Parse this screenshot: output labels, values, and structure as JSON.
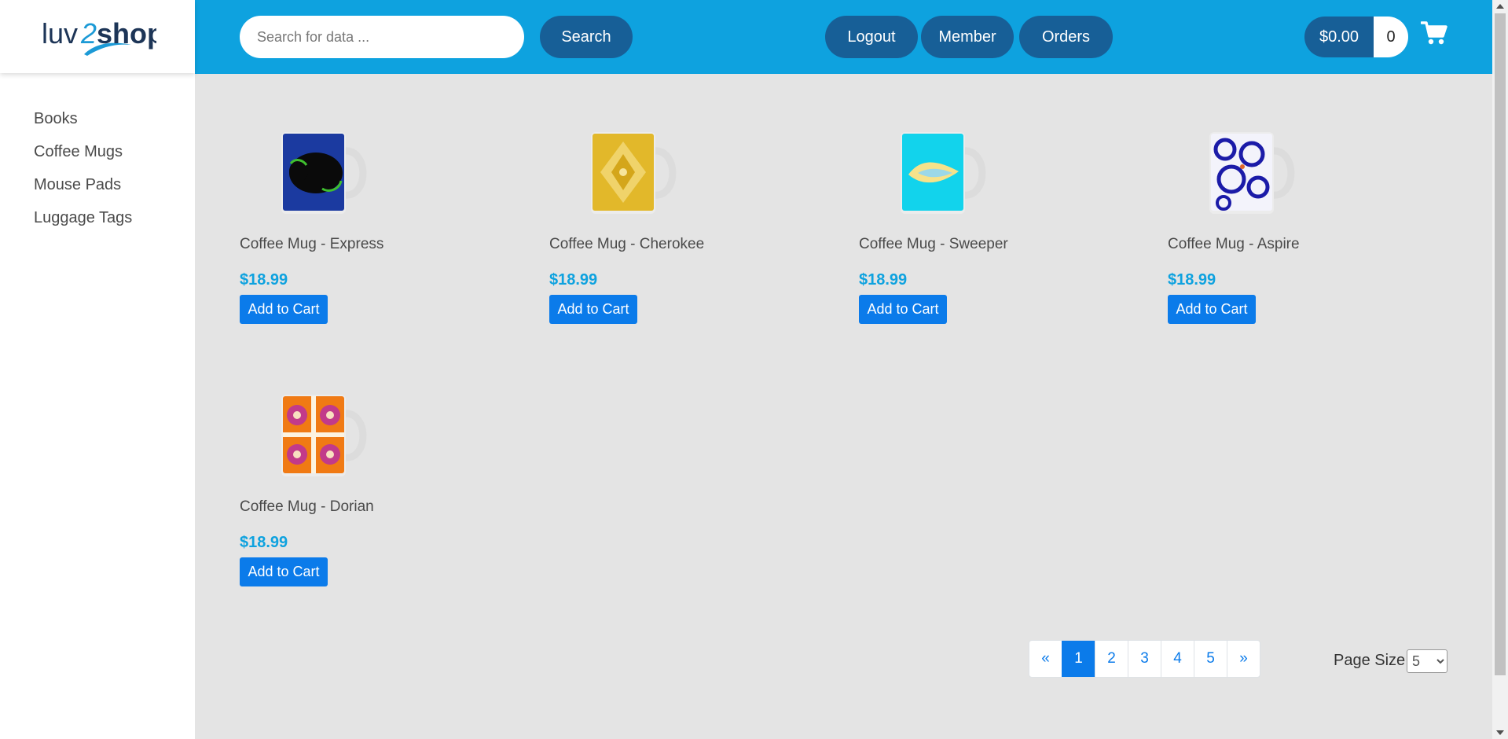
{
  "header": {
    "search_placeholder": "Search for data ...",
    "search_button": "Search",
    "logout": "Logout",
    "member": "Member",
    "orders": "Orders",
    "cart_total": "$0.00",
    "cart_quantity": "0"
  },
  "logo": {
    "text_part1": "luv",
    "text_part2": "2",
    "text_part3": "shop"
  },
  "sidebar": {
    "items": [
      {
        "label": "Books"
      },
      {
        "label": "Coffee Mugs"
      },
      {
        "label": "Mouse Pads"
      },
      {
        "label": "Luggage Tags"
      }
    ]
  },
  "products": [
    {
      "name": "Coffee Mug - Express",
      "price": "$18.99",
      "button": "Add to Cart"
    },
    {
      "name": "Coffee Mug - Cherokee",
      "price": "$18.99",
      "button": "Add to Cart"
    },
    {
      "name": "Coffee Mug - Sweeper",
      "price": "$18.99",
      "button": "Add to Cart"
    },
    {
      "name": "Coffee Mug - Aspire",
      "price": "$18.99",
      "button": "Add to Cart"
    },
    {
      "name": "Coffee Mug - Dorian",
      "price": "$18.99",
      "button": "Add to Cart"
    }
  ],
  "pagination": {
    "prev": "«",
    "pages": [
      "1",
      "2",
      "3",
      "4",
      "5"
    ],
    "next": "»",
    "active_page": "1"
  },
  "page_size": {
    "label": "Page Size",
    "selected": "5"
  },
  "colors": {
    "header": "#0ea2df",
    "pill": "#175f97",
    "primary_button": "#0b7bea",
    "price": "#0ea2df",
    "background": "#e4e4e4"
  }
}
